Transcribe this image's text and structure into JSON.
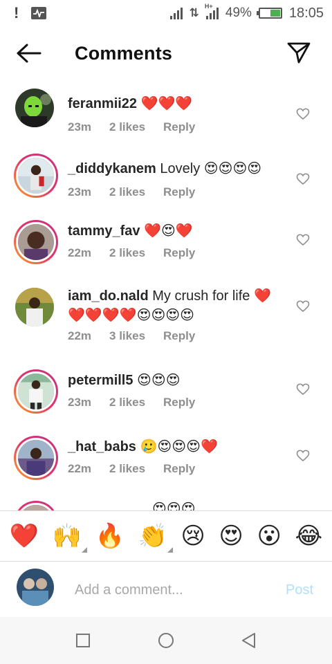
{
  "status_bar": {
    "battery": "49%",
    "time": "18:05",
    "battery_level": 0.49,
    "network_label": "H+"
  },
  "header": {
    "title": "Comments"
  },
  "comments": [
    {
      "username": "feranmii22",
      "text": "❤️❤️❤️",
      "age": "23m",
      "likes": "2 likes",
      "reply": "Reply",
      "avatar": "green-balaclava-avatar"
    },
    {
      "username": "_diddykanem",
      "text": "Lovely 😍😍😍😍",
      "age": "23m",
      "likes": "2 likes",
      "reply": "Reply",
      "avatar": "woman-red-outfit-avatar"
    },
    {
      "username": "tammy_fav",
      "text": "❤️😍❤️",
      "age": "22m",
      "likes": "2 likes",
      "reply": "Reply",
      "avatar": "woman-selfie-avatar"
    },
    {
      "username": "iam_do.nald",
      "text": "My crush for life ❤️ ❤️❤️❤️❤️😍😍😍😍",
      "age": "22m",
      "likes": "3 likes",
      "reply": "Reply",
      "avatar": "man-outdoors-avatar"
    },
    {
      "username": "petermill5",
      "text": "😍😍😍",
      "age": "23m",
      "likes": "2 likes",
      "reply": "Reply",
      "avatar": "man-white-outfit-avatar"
    },
    {
      "username": "_hat_babs",
      "text": "🥲😍😍😍❤️",
      "age": "22m",
      "likes": "2 likes",
      "reply": "Reply",
      "avatar": "man-purple-avatar"
    }
  ],
  "partial_comment": {
    "text": "😍😍😍"
  },
  "emoji_bar": [
    "❤️",
    "🙌",
    "🔥",
    "👏",
    "😢",
    "😍",
    "😮",
    "😂"
  ],
  "add_comment": {
    "placeholder": "Add a comment...",
    "post_label": "Post"
  }
}
